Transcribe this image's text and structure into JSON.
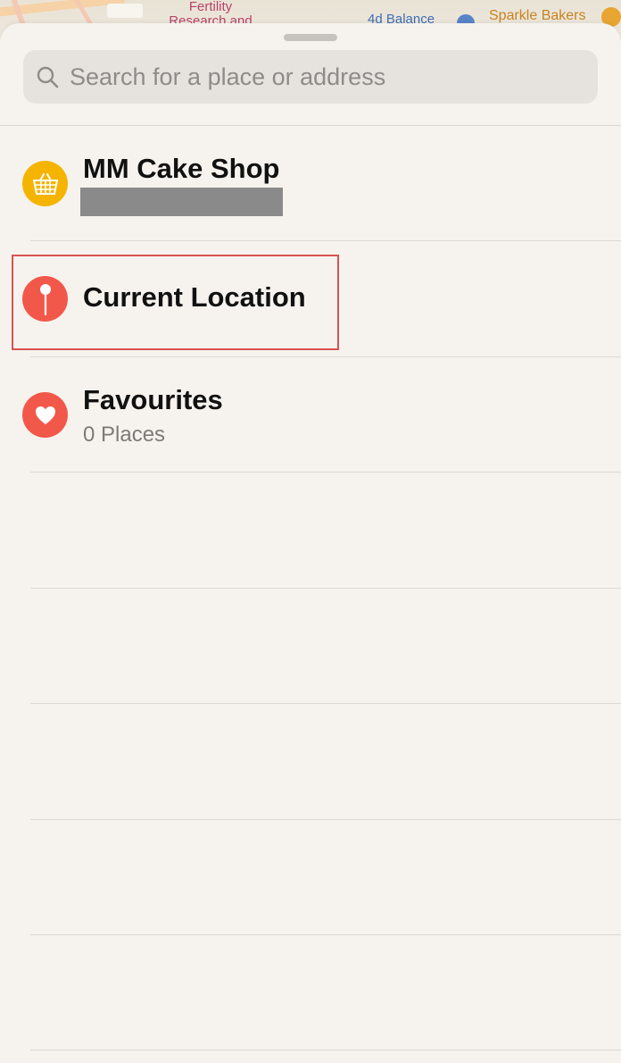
{
  "map": {
    "labels": {
      "fertility": "Fertility\nResearch and",
      "balance": "4d Balance",
      "bakers": "Sparkle Bakers"
    }
  },
  "search": {
    "placeholder": "Search for a place or address",
    "value": ""
  },
  "list": {
    "items": [
      {
        "title": "MM Cake Shop",
        "subtitle": "",
        "icon": "basket-icon",
        "color": "#f4b400"
      },
      {
        "title": "Current Location",
        "subtitle": "",
        "icon": "pin-icon",
        "color": "#f2584a"
      },
      {
        "title": "Favourites",
        "subtitle": "0 Places",
        "icon": "heart-icon",
        "color": "#f2584a"
      }
    ]
  },
  "colors": {
    "sheet": "#f6f3ee",
    "highlight": "#d9534f"
  }
}
